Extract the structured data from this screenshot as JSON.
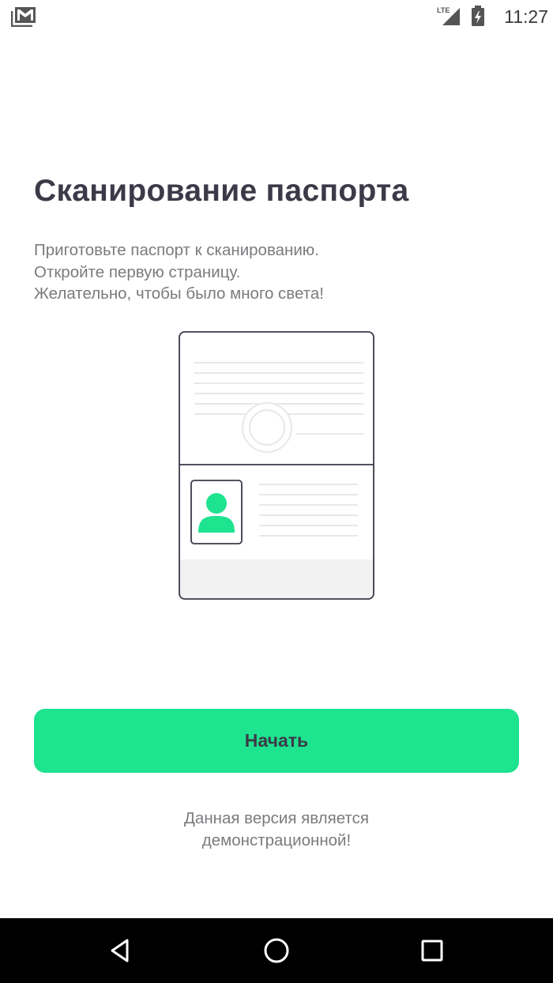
{
  "status_bar": {
    "time": "11:27",
    "network": "LTE",
    "icons": [
      "gmail-icon",
      "lte-signal-icon",
      "battery-charging-icon"
    ]
  },
  "main": {
    "title": "Сканирование паспорта",
    "instructions": [
      "Приготовьте паспорт к сканированию.",
      "Откройте первую страницу.",
      "Желательно, чтобы было много света!"
    ]
  },
  "illustration": {
    "icon": "passport-icon",
    "accent_color": "#1ee38f"
  },
  "actions": {
    "start_label": "Начать"
  },
  "footer": {
    "demo_note": [
      "Данная версия является",
      "демонстрационной!"
    ]
  },
  "nav_bar": {
    "icons": [
      "back-icon",
      "home-icon",
      "recents-icon"
    ]
  },
  "colors": {
    "accent": "#1ee38f",
    "title": "#3b3a48",
    "body_text": "#7b7b7f",
    "nav_background": "#000000"
  }
}
